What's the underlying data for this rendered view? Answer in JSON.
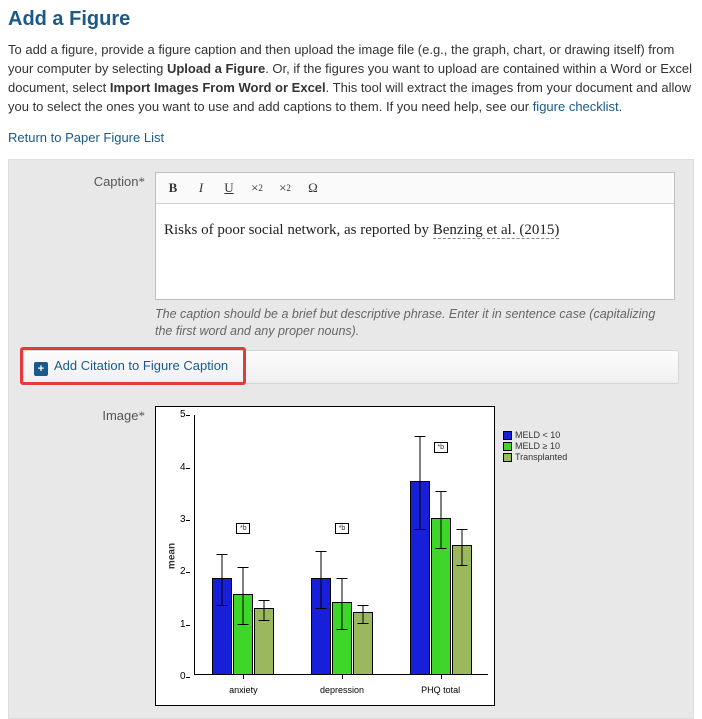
{
  "page": {
    "title": "Add a Figure",
    "intro_1": "To add a figure, provide a figure caption and then upload the image file (e.g., the graph, chart, or drawing itself) from your computer by selecting ",
    "intro_bold_1": "Upload a Figure",
    "intro_2": ". Or, if the figures you want to upload are contained within a Word or Excel document, select ",
    "intro_bold_2": "Import Images From Word or Excel",
    "intro_3": ". This tool will extract the images from your document and allow you to select the ones you want to use and add captions to them. If you need help, see our ",
    "intro_link": "figure checklist",
    "intro_4": ".",
    "return_link": "Return to Paper Figure List"
  },
  "caption": {
    "label": "Caption",
    "required": "*",
    "toolbar": {
      "bold": "B",
      "italic": "I",
      "underline": "U",
      "super": "×",
      "sub": "×",
      "omega": "Ω"
    },
    "content_prefix": "Risks of poor social network, as reported by ",
    "content_cite": "Benzing et al. (2015)",
    "hint": "The caption should be a brief but descriptive phrase. Enter it in sentence case (capitalizing the first word and any proper nouns)."
  },
  "citation": {
    "button_label": "Add Citation to Figure Caption",
    "plus": "+"
  },
  "image": {
    "label": "Image",
    "required": "*"
  },
  "chart_data": {
    "type": "bar",
    "categories": [
      "anxiety",
      "depression",
      "PHQ total"
    ],
    "series": [
      {
        "name": "MELD < 10",
        "color": "#1720d8",
        "values": [
          1.85,
          1.85,
          3.7
        ],
        "err": [
          0.5,
          0.55,
          0.9
        ]
      },
      {
        "name": "MELD ≥ 10",
        "color": "#3fd62a",
        "values": [
          1.55,
          1.4,
          3.0
        ],
        "err": [
          0.55,
          0.5,
          0.55
        ]
      },
      {
        "name": "Transplanted",
        "color": "#9bb85f",
        "values": [
          1.28,
          1.2,
          2.48
        ],
        "err": [
          0.2,
          0.18,
          0.35
        ]
      }
    ],
    "ylabel": "mean",
    "ylim": [
      0,
      5
    ],
    "yticks": [
      0,
      1,
      2,
      3,
      4,
      5
    ],
    "sig_marks": {
      "label": "*b",
      "positions": [
        2.85,
        2.85,
        4.4
      ]
    }
  }
}
